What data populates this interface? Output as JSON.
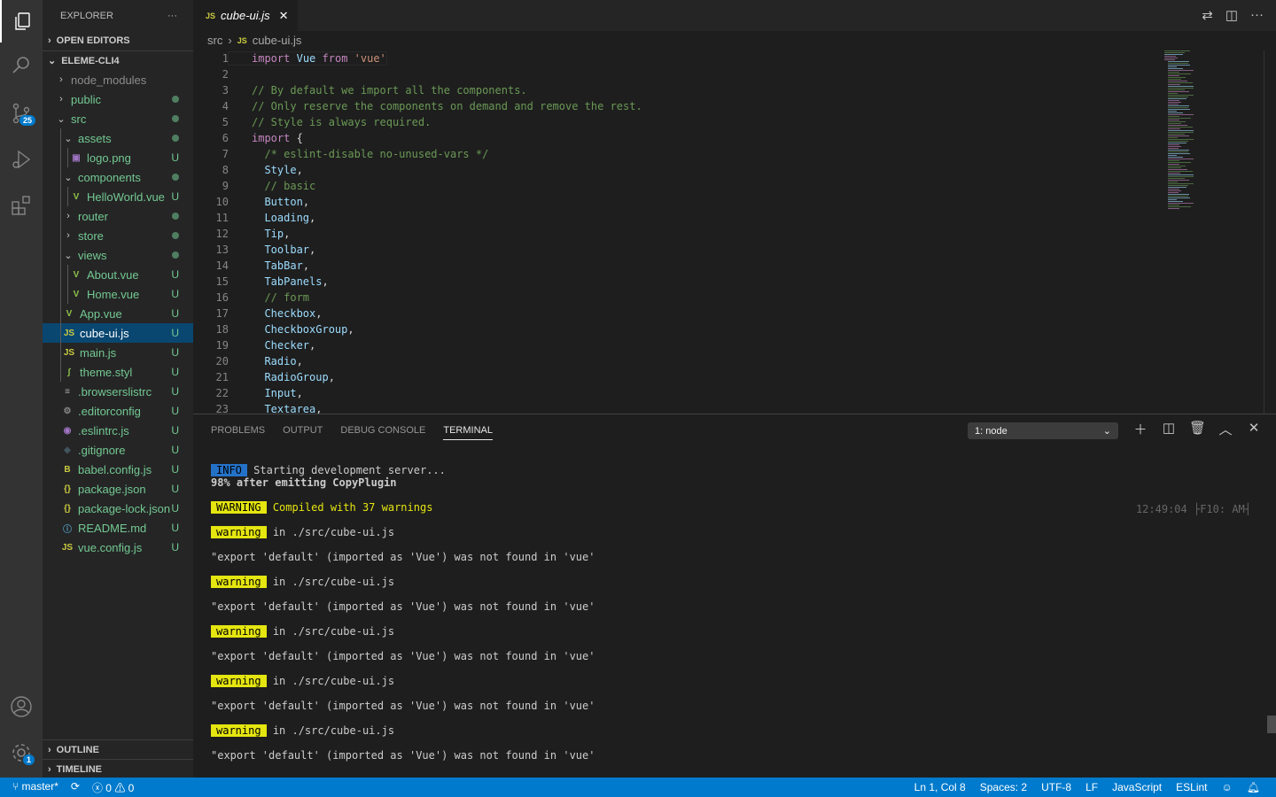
{
  "activity": {
    "scm_badge": "25",
    "settings_badge": "1"
  },
  "sidebar": {
    "title": "EXPLORER",
    "more": "···",
    "open_editors": "OPEN EDITORS",
    "root": "ELEME-CLI4",
    "outline": "OUTLINE",
    "timeline": "TIMELINE",
    "items": [
      {
        "name": "node_modules",
        "depth": 0,
        "kind": "folder",
        "open": false,
        "color": "#8c8c8c",
        "status": ""
      },
      {
        "name": "public",
        "depth": 0,
        "kind": "folder",
        "open": false,
        "color": "#73c991",
        "status": "dot"
      },
      {
        "name": "src",
        "depth": 0,
        "kind": "folder",
        "open": true,
        "color": "#73c991",
        "status": "dot"
      },
      {
        "name": "assets",
        "depth": 1,
        "kind": "folder",
        "open": true,
        "color": "#73c991",
        "status": "dot"
      },
      {
        "name": "logo.png",
        "depth": 2,
        "kind": "file",
        "icon": "image",
        "color": "#73c991",
        "status": "U"
      },
      {
        "name": "components",
        "depth": 1,
        "kind": "folder",
        "open": true,
        "color": "#73c991",
        "status": "dot"
      },
      {
        "name": "HelloWorld.vue",
        "depth": 2,
        "kind": "file",
        "icon": "vue",
        "color": "#73c991",
        "status": "U"
      },
      {
        "name": "router",
        "depth": 1,
        "kind": "folder",
        "open": false,
        "color": "#73c991",
        "status": "dot"
      },
      {
        "name": "store",
        "depth": 1,
        "kind": "folder",
        "open": false,
        "color": "#73c991",
        "status": "dot"
      },
      {
        "name": "views",
        "depth": 1,
        "kind": "folder",
        "open": true,
        "color": "#73c991",
        "status": "dot"
      },
      {
        "name": "About.vue",
        "depth": 2,
        "kind": "file",
        "icon": "vue",
        "color": "#73c991",
        "status": "U"
      },
      {
        "name": "Home.vue",
        "depth": 2,
        "kind": "file",
        "icon": "vue",
        "color": "#73c991",
        "status": "U"
      },
      {
        "name": "App.vue",
        "depth": 1,
        "kind": "file",
        "icon": "vue",
        "color": "#73c991",
        "status": "U"
      },
      {
        "name": "cube-ui.js",
        "depth": 1,
        "kind": "file",
        "icon": "js",
        "color": "#ffffff",
        "status": "U",
        "selected": true
      },
      {
        "name": "main.js",
        "depth": 1,
        "kind": "file",
        "icon": "js",
        "color": "#73c991",
        "status": "U"
      },
      {
        "name": "theme.styl",
        "depth": 1,
        "kind": "file",
        "icon": "stylus",
        "color": "#73c991",
        "status": "U"
      },
      {
        "name": ".browserslistrc",
        "depth": 0,
        "kind": "file",
        "icon": "lines",
        "color": "#73c991",
        "status": "U"
      },
      {
        "name": ".editorconfig",
        "depth": 0,
        "kind": "file",
        "icon": "gear",
        "color": "#73c991",
        "status": "U"
      },
      {
        "name": ".eslintrc.js",
        "depth": 0,
        "kind": "file",
        "icon": "eslint",
        "color": "#73c991",
        "status": "U"
      },
      {
        "name": ".gitignore",
        "depth": 0,
        "kind": "file",
        "icon": "git",
        "color": "#73c991",
        "status": "U"
      },
      {
        "name": "babel.config.js",
        "depth": 0,
        "kind": "file",
        "icon": "babel",
        "color": "#73c991",
        "status": "U"
      },
      {
        "name": "package.json",
        "depth": 0,
        "kind": "file",
        "icon": "json",
        "color": "#73c991",
        "status": "U"
      },
      {
        "name": "package-lock.json",
        "depth": 0,
        "kind": "file",
        "icon": "json",
        "color": "#73c991",
        "status": "U"
      },
      {
        "name": "README.md",
        "depth": 0,
        "kind": "file",
        "icon": "info",
        "color": "#73c991",
        "status": "U"
      },
      {
        "name": "vue.config.js",
        "depth": 0,
        "kind": "file",
        "icon": "js",
        "color": "#73c991",
        "status": "U"
      }
    ]
  },
  "editor": {
    "tab": "cube-ui.js",
    "tab_icon": "JS",
    "breadcrumb": [
      "src",
      "cube-ui.js"
    ],
    "lines": [
      [
        [
          "import",
          "kw"
        ],
        " ",
        [
          "Vue",
          "id"
        ],
        " ",
        [
          "from",
          "kw"
        ],
        " ",
        [
          "'vue'",
          "str"
        ]
      ],
      [],
      [
        [
          "// By default we import all the components.",
          "cm"
        ]
      ],
      [
        [
          "// Only reserve the components on demand and remove the rest.",
          "cm"
        ]
      ],
      [
        [
          "// Style is always required.",
          "cm"
        ]
      ],
      [
        [
          "import",
          "kw"
        ],
        " {"
      ],
      [
        "  ",
        [
          "/* eslint-disable no-unused-vars */",
          "cm"
        ]
      ],
      [
        "  ",
        [
          "Style",
          "id"
        ],
        ","
      ],
      [
        "  ",
        [
          "// basic",
          "cm"
        ]
      ],
      [
        "  ",
        [
          "Button",
          "id"
        ],
        ","
      ],
      [
        "  ",
        [
          "Loading",
          "id"
        ],
        ","
      ],
      [
        "  ",
        [
          "Tip",
          "id"
        ],
        ","
      ],
      [
        "  ",
        [
          "Toolbar",
          "id"
        ],
        ","
      ],
      [
        "  ",
        [
          "TabBar",
          "id"
        ],
        ","
      ],
      [
        "  ",
        [
          "TabPanels",
          "id"
        ],
        ","
      ],
      [
        "  ",
        [
          "// form",
          "cm"
        ]
      ],
      [
        "  ",
        [
          "Checkbox",
          "id"
        ],
        ","
      ],
      [
        "  ",
        [
          "CheckboxGroup",
          "id"
        ],
        ","
      ],
      [
        "  ",
        [
          "Checker",
          "id"
        ],
        ","
      ],
      [
        "  ",
        [
          "Radio",
          "id"
        ],
        ","
      ],
      [
        "  ",
        [
          "RadioGroup",
          "id"
        ],
        ","
      ],
      [
        "  ",
        [
          "Input",
          "id"
        ],
        ","
      ],
      [
        "  ",
        [
          "Textarea",
          "id"
        ],
        ","
      ]
    ]
  },
  "panel": {
    "tabs": [
      "PROBLEMS",
      "OUTPUT",
      "DEBUG CONSOLE",
      "TERMINAL"
    ],
    "active": 3,
    "terminal_select": "1: node",
    "timestamp": "12:49:04 ├F10: AM┤",
    "terminal": [
      {
        "tag": "INFO",
        "tagtype": "info",
        "text": "Starting development server..."
      },
      {
        "text": "98% after emitting CopyPlugin",
        "bold": true
      },
      {
        "gap": true
      },
      {
        "tag": "WARNING",
        "tagtype": "warn",
        "text": "Compiled with 37 warnings",
        "yellow": true
      },
      {
        "gap": true
      },
      {
        "tag": "warning",
        "tagtype": "warn",
        "text": "in ./src/cube-ui.js"
      },
      {
        "gap": true
      },
      {
        "text": "\"export 'default' (imported as 'Vue') was not found in 'vue'"
      },
      {
        "gap": true
      },
      {
        "tag": "warning",
        "tagtype": "warn",
        "text": "in ./src/cube-ui.js"
      },
      {
        "gap": true
      },
      {
        "text": "\"export 'default' (imported as 'Vue') was not found in 'vue'"
      },
      {
        "gap": true
      },
      {
        "tag": "warning",
        "tagtype": "warn",
        "text": "in ./src/cube-ui.js"
      },
      {
        "gap": true
      },
      {
        "text": "\"export 'default' (imported as 'Vue') was not found in 'vue'"
      },
      {
        "gap": true
      },
      {
        "tag": "warning",
        "tagtype": "warn",
        "text": "in ./src/cube-ui.js"
      },
      {
        "gap": true
      },
      {
        "text": "\"export 'default' (imported as 'Vue') was not found in 'vue'"
      },
      {
        "gap": true
      },
      {
        "tag": "warning",
        "tagtype": "warn",
        "text": "in ./src/cube-ui.js"
      },
      {
        "gap": true
      },
      {
        "text": "\"export 'default' (imported as 'Vue') was not found in 'vue'"
      }
    ]
  },
  "status": {
    "branch": "master*",
    "errors": "0",
    "warnings": "0",
    "position": "Ln 1, Col 8",
    "spaces": "Spaces: 2",
    "encoding": "UTF-8",
    "eol": "LF",
    "language": "JavaScript",
    "linter": "ESLint"
  },
  "colors": {
    "accent": "#007acc",
    "untracked": "#73c991",
    "warning_bg": "#e5e510",
    "info_bg": "#2472c8"
  }
}
